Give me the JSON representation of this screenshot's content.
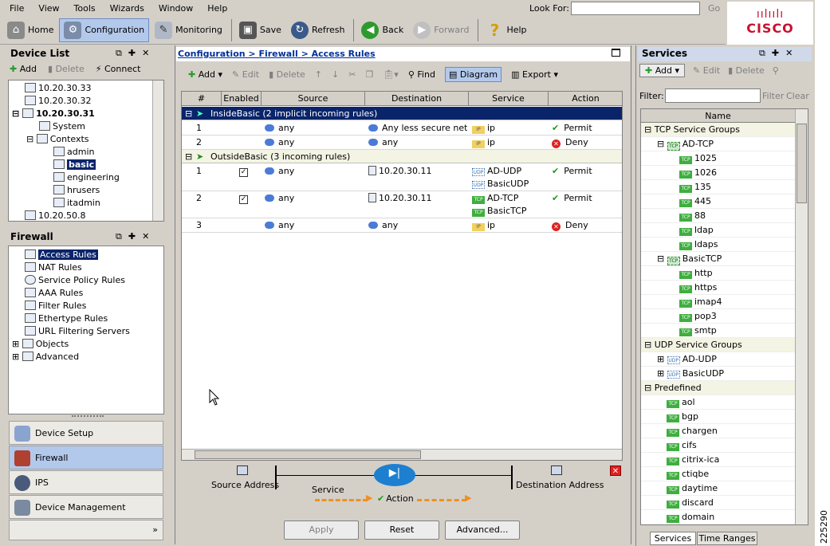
{
  "menu": [
    "File",
    "View",
    "Tools",
    "Wizards",
    "Window",
    "Help"
  ],
  "lookfor": {
    "label": "Look For:",
    "go": "Go"
  },
  "toolbar": {
    "home": "Home",
    "configuration": "Configuration",
    "monitoring": "Monitoring",
    "save": "Save",
    "refresh": "Refresh",
    "back": "Back",
    "forward": "Forward",
    "help": "Help"
  },
  "logo": "CISCO",
  "device_list": {
    "title": "Device List",
    "add": "Add",
    "delete": "Delete",
    "connect": "Connect",
    "items": [
      "10.20.30.33",
      "10.20.30.32",
      "10.20.30.31",
      "System",
      "Contexts",
      "admin",
      "basic",
      "engineering",
      "hrusers",
      "itadmin",
      "10.20.50.8"
    ]
  },
  "firewall": {
    "title": "Firewall",
    "items": [
      "Access Rules",
      "NAT Rules",
      "Service Policy Rules",
      "AAA Rules",
      "Filter Rules",
      "Ethertype Rules",
      "URL Filtering Servers",
      "Objects",
      "Advanced"
    ]
  },
  "nav": [
    "Device Setup",
    "Firewall",
    "IPS",
    "Device Management"
  ],
  "breadcrumb": "Configuration > Firewall > Access Rules",
  "rules_toolbar": {
    "add": "Add",
    "edit": "Edit",
    "delete": "Delete",
    "find": "Find",
    "diagram": "Diagram",
    "export": "Export"
  },
  "columns": [
    "#",
    "Enabled",
    "Source",
    "Destination",
    "Service",
    "Action"
  ],
  "groups": [
    {
      "label": "InsideBasic (2 implicit incoming rules)",
      "rows": [
        {
          "num": "1",
          "enabled": false,
          "source": "any",
          "dest": "Any less secure net...",
          "services": [
            {
              "type": "IP",
              "name": "ip"
            }
          ],
          "action": "Permit"
        },
        {
          "num": "2",
          "enabled": false,
          "source": "any",
          "dest": "any",
          "services": [
            {
              "type": "IP",
              "name": "ip"
            }
          ],
          "action": "Deny"
        }
      ]
    },
    {
      "label": "OutsideBasic (3 incoming rules)",
      "rows": [
        {
          "num": "1",
          "enabled": true,
          "source": "any",
          "dest": "10.20.30.11",
          "services": [
            {
              "type": "UDP",
              "name": "AD-UDP"
            },
            {
              "type": "UDP",
              "name": "BasicUDP"
            }
          ],
          "action": "Permit"
        },
        {
          "num": "2",
          "enabled": true,
          "source": "any",
          "dest": "10.20.30.11",
          "services": [
            {
              "type": "TCP",
              "name": "AD-TCP"
            },
            {
              "type": "TCP",
              "name": "BasicTCP"
            }
          ],
          "action": "Permit"
        },
        {
          "num": "3",
          "enabled": false,
          "source": "any",
          "dest": "any",
          "services": [
            {
              "type": "IP",
              "name": "ip"
            }
          ],
          "action": "Deny"
        }
      ]
    }
  ],
  "diagram": {
    "source": "Source Address",
    "service": "Service",
    "action": "Action",
    "dest": "Destination Address"
  },
  "buttons": {
    "apply": "Apply",
    "reset": "Reset",
    "advanced": "Advanced..."
  },
  "services": {
    "title": "Services",
    "add": "Add",
    "edit": "Edit",
    "delete": "Delete",
    "filter_label": "Filter:",
    "filter_btn": "Filter",
    "clear_btn": "Clear",
    "col_name": "Name",
    "tree": [
      {
        "l": 0,
        "t": "group",
        "n": "TCP Service Groups"
      },
      {
        "l": 1,
        "t": "tcpgrp",
        "n": "AD-TCP"
      },
      {
        "l": 2,
        "t": "tcp",
        "n": "1025"
      },
      {
        "l": 2,
        "t": "tcp",
        "n": "1026"
      },
      {
        "l": 2,
        "t": "tcp",
        "n": "135"
      },
      {
        "l": 2,
        "t": "tcp",
        "n": "445"
      },
      {
        "l": 2,
        "t": "tcp",
        "n": "88"
      },
      {
        "l": 2,
        "t": "tcp",
        "n": "ldap"
      },
      {
        "l": 2,
        "t": "tcp",
        "n": "ldaps"
      },
      {
        "l": 1,
        "t": "tcpgrp",
        "n": "BasicTCP"
      },
      {
        "l": 2,
        "t": "tcp",
        "n": "http"
      },
      {
        "l": 2,
        "t": "tcp",
        "n": "https"
      },
      {
        "l": 2,
        "t": "tcp",
        "n": "imap4"
      },
      {
        "l": 2,
        "t": "tcp",
        "n": "pop3"
      },
      {
        "l": 2,
        "t": "tcp",
        "n": "smtp"
      },
      {
        "l": 0,
        "t": "group",
        "n": "UDP Service Groups"
      },
      {
        "l": 1,
        "t": "udpgrp",
        "n": "AD-UDP"
      },
      {
        "l": 1,
        "t": "udpgrp",
        "n": "BasicUDP"
      },
      {
        "l": 0,
        "t": "group",
        "n": "Predefined"
      },
      {
        "l": 1,
        "t": "tcp",
        "n": "aol"
      },
      {
        "l": 1,
        "t": "tcp",
        "n": "bgp"
      },
      {
        "l": 1,
        "t": "tcp",
        "n": "chargen"
      },
      {
        "l": 1,
        "t": "tcp",
        "n": "cifs"
      },
      {
        "l": 1,
        "t": "tcp",
        "n": "citrix-ica"
      },
      {
        "l": 1,
        "t": "tcp",
        "n": "ctiqbe"
      },
      {
        "l": 1,
        "t": "tcp",
        "n": "daytime"
      },
      {
        "l": 1,
        "t": "tcp",
        "n": "discard"
      },
      {
        "l": 1,
        "t": "tcp",
        "n": "domain"
      }
    ],
    "tabs": [
      "Services",
      "Time Ranges"
    ]
  },
  "figure_id": "225290",
  "colors": {
    "selection": "#0a246a",
    "group_bar": "#0a246a",
    "accent": "#b3c9ec"
  }
}
